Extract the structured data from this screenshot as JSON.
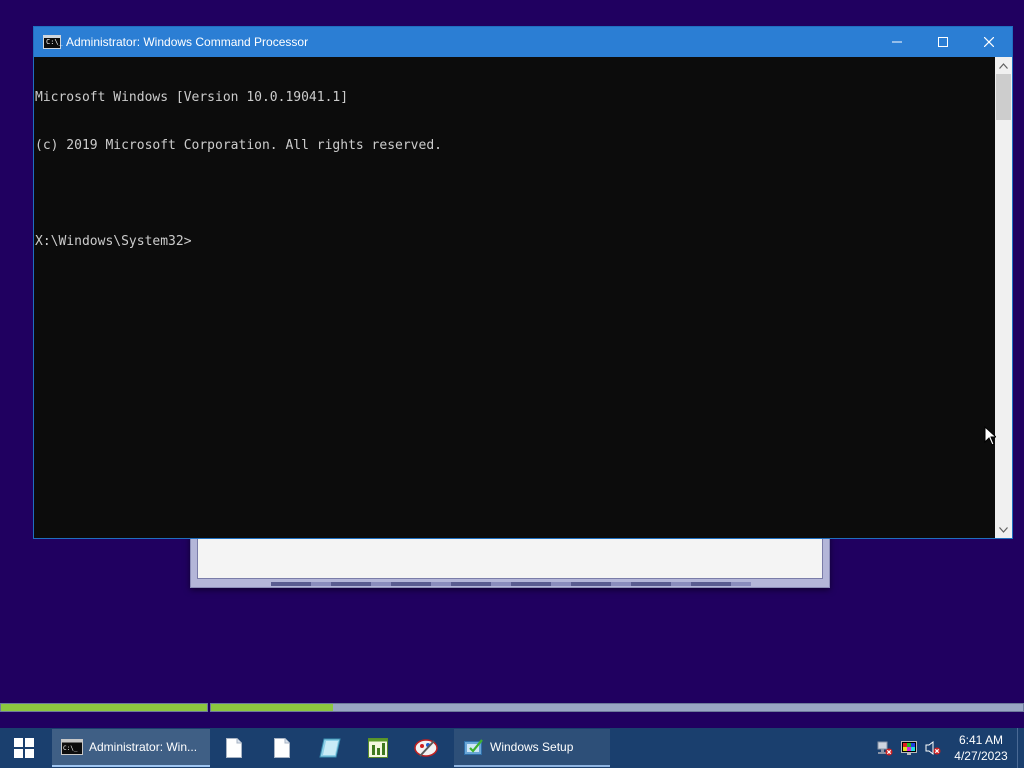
{
  "desktop": {
    "background_color": "#200060"
  },
  "cmd_window": {
    "title": "Administrator: Windows Command Processor",
    "app_icon_glyph": "C:\\_",
    "controls": {
      "minimize": "—",
      "maximize": "☐",
      "close": "✕"
    },
    "console_lines": [
      "Microsoft Windows [Version 10.0.19041.1]",
      "(c) 2019 Microsoft Corporation. All rights reserved.",
      "",
      "X:\\Windows\\System32>"
    ]
  },
  "setup_progress": {
    "bar1_fraction": 1.0,
    "bar2_fraction": 0.15
  },
  "taskbar": {
    "start_icon": "windows-logo-icon",
    "tasks": [
      {
        "label": "Administrator: Win...",
        "icon": "cmd-icon",
        "state": "active"
      },
      {
        "label": "Windows Setup",
        "icon": "setup-icon",
        "state": "open"
      }
    ],
    "pinned_icons": [
      "document-icon",
      "document-icon",
      "notepad-icon",
      "registry-editor-icon",
      "paint-icon"
    ],
    "tray_icons": [
      "network-error-icon",
      "display-color-icon",
      "volume-muted-icon"
    ],
    "clock": {
      "time": "6:41 AM",
      "date": "4/27/2023"
    }
  }
}
